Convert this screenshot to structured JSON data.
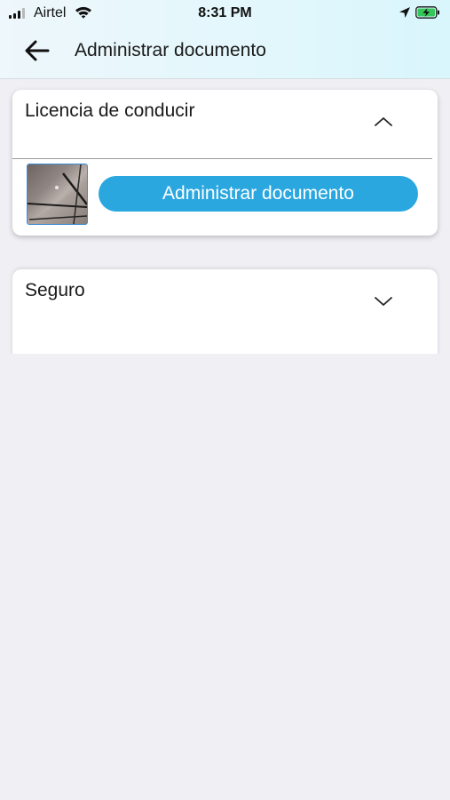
{
  "status_bar": {
    "carrier": "Airtel",
    "time": "8:31 PM"
  },
  "header": {
    "title": "Administrar documento",
    "back_icon": "arrow-left-icon"
  },
  "sections": [
    {
      "title": "Licencia de conducir",
      "expanded": true,
      "chevron_icon": "chevron-up-icon",
      "button_label": "Administrar documento"
    },
    {
      "title": "Seguro",
      "expanded": false,
      "chevron_icon": "chevron-down-icon"
    }
  ],
  "colors": {
    "accent": "#2ba7e0",
    "background": "#efeff4",
    "header": "#e2f7fc",
    "battery": "#34c759"
  }
}
